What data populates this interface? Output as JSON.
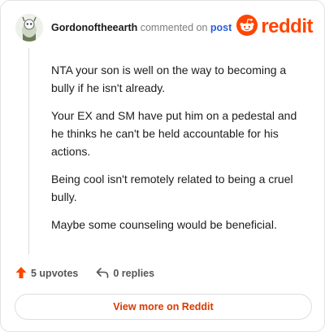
{
  "comment": {
    "author": "Gordonoftheearth",
    "action": "commented on",
    "target_link": "post",
    "paragraphs": [
      "NTA your son is well on the way to becoming a bully if he isn't already.",
      "Your EX and SM have put him on a pedestal and he thinks he can't be held accountable for his actions.",
      "Being cool isn't remotely related to being a cruel bully.",
      "Maybe some counseling would be beneficial."
    ]
  },
  "brand": {
    "wordmark": "reddit",
    "color": "#ff4500"
  },
  "footer": {
    "upvotes": "5 upvotes",
    "replies": "0 replies"
  },
  "cta": {
    "label": "View more on Reddit"
  },
  "colors": {
    "upvote_arrow": "#ff4500",
    "link": "#2a5fd7",
    "cta_text": "#d93a00"
  },
  "icons": [
    "avatar",
    "reddit-logo-icon",
    "upvote-arrow-icon",
    "reply-icon"
  ]
}
